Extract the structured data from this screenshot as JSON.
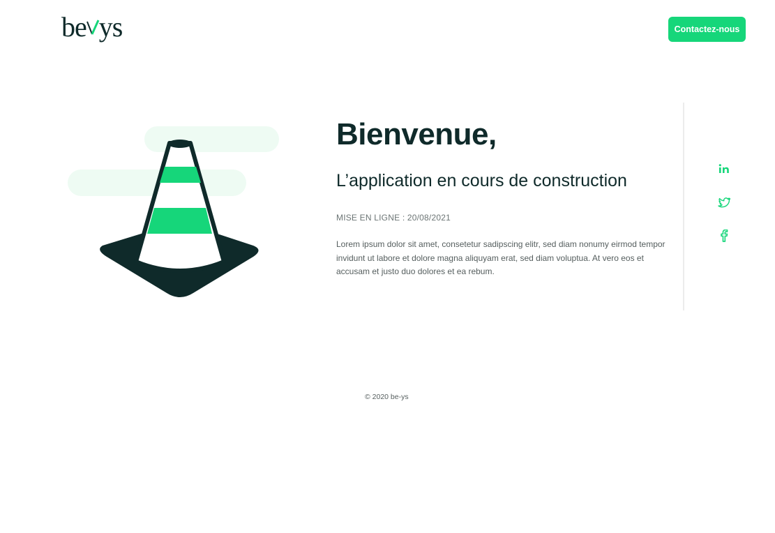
{
  "header": {
    "logo_left": "be",
    "logo_right": "ys",
    "contact_label": "Contactez-nous"
  },
  "hero": {
    "title": "Bienvenue,",
    "subtitle": "L’application en cours de construction",
    "launch_date": "MISE EN LIGNE : 20/08/2021",
    "description": "Lorem ipsum dolor sit amet, consetetur sadipscing elitr, sed diam nonumy eirmod tempor invidunt ut labore et dolore magna aliquyam erat, sed diam voluptua. At vero eos et accusam et justo duo dolores et ea rebum."
  },
  "social": {
    "icons": [
      "linkedin-icon",
      "twitter-icon",
      "facebook-icon"
    ]
  },
  "footer": {
    "copyright": "© 2020 be-ys"
  },
  "colors": {
    "accent": "#16d67a",
    "dark": "#0f2a2a",
    "illustration_bg": "#eefbf3"
  }
}
